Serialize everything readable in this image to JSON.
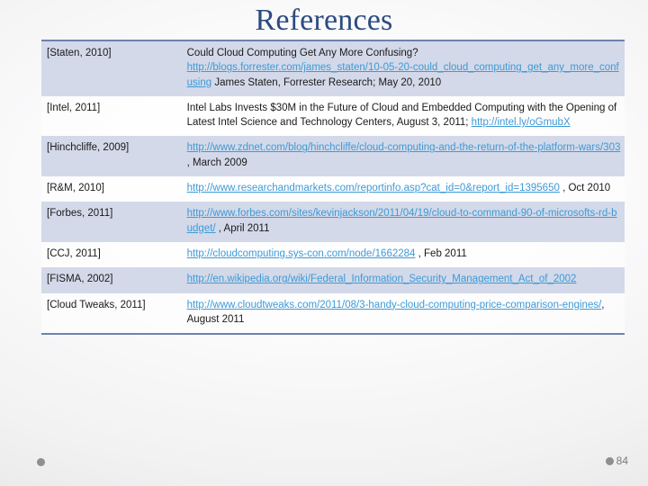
{
  "slide": {
    "title": "References",
    "page_number": "84",
    "accent_color": "#2d4b80",
    "link_color": "#3e9ad6",
    "row_shade_color": "#d3d9e9",
    "table_border_color": "#6d82ad"
  },
  "references": [
    {
      "key": "[Staten, 2010]",
      "parts": [
        {
          "type": "text",
          "value": "Could Cloud Computing Get Any More Confusing?"
        },
        {
          "type": "break"
        },
        {
          "type": "link",
          "value": "http://blogs.forrester.com/james_staten/10-05-20-could_cloud_computing_get_any_more_confusing"
        },
        {
          "type": "text",
          "value": " James Staten, Forrester Research;  May 20, 2010"
        }
      ]
    },
    {
      "key": "[Intel, 2011]",
      "parts": [
        {
          "type": "text",
          "value": "Intel Labs Invests $30M in the Future of Cloud and Embedded Computing with the Opening of Latest Intel Science and Technology Centers, August 3, 2011; "
        },
        {
          "type": "link",
          "value": "http://intel.ly/oGmubX"
        }
      ]
    },
    {
      "key": "[Hinchcliffe, 2009]",
      "parts": [
        {
          "type": "link",
          "value": "http://www.zdnet.com/blog/hinchcliffe/cloud-computing-and-the-return-of-the-platform-wars/303"
        },
        {
          "type": "text",
          "value": " , March 2009"
        }
      ]
    },
    {
      "key": "[R&M, 2010]",
      "parts": [
        {
          "type": "link",
          "value": "http://www.researchandmarkets.com/reportinfo.asp?cat_id=0&report_id=1395650"
        },
        {
          "type": "text",
          "value": " , Oct 2010"
        }
      ]
    },
    {
      "key": "[Forbes, 2011]",
      "parts": [
        {
          "type": "link",
          "value": "http://www.forbes.com/sites/kevinjackson/2011/04/19/cloud-to-command-90-of-microsofts-rd-budget/"
        },
        {
          "type": "text",
          "value": " , April 2011"
        }
      ]
    },
    {
      "key": "[CCJ, 2011]",
      "parts": [
        {
          "type": "link",
          "value": "http://cloudcomputing.sys-con.com/node/1662284"
        },
        {
          "type": "text",
          "value": " , Feb 2011"
        }
      ]
    },
    {
      "key": "[FISMA, 2002]",
      "parts": [
        {
          "type": "link",
          "value": "http://en.wikipedia.org/wiki/Federal_Information_Security_Management_Act_of_2002"
        }
      ]
    },
    {
      "key": "[Cloud Tweaks, 2011]",
      "parts": [
        {
          "type": "link",
          "value": "http://www.cloudtweaks.com/2011/08/3-handy-cloud-computing-price-comparison-engines/"
        },
        {
          "type": "text",
          "value": ", August 2011"
        }
      ]
    }
  ]
}
